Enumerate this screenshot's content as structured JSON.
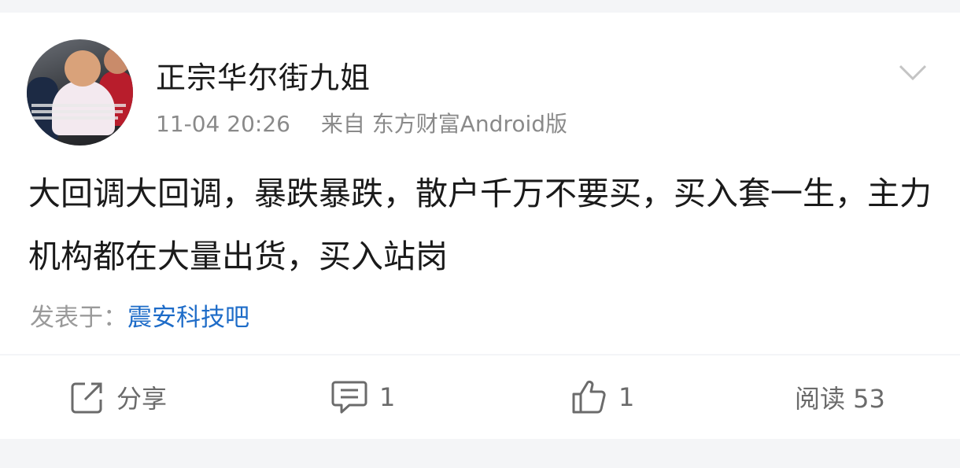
{
  "post": {
    "username": "正宗华尔街九姐",
    "time": "11-04 20:26",
    "source": "来自 东方财富Android版",
    "content": "大回调大回调，暴跌暴跌，散户千万不要买，买入套一生，主力机构都在大量出货，买入站岗",
    "posted_in_label": "发表于：",
    "forum": "震安科技吧"
  },
  "actions": {
    "share_label": "分享",
    "comment_count": "1",
    "like_count": "1",
    "read_label": "阅读 53"
  },
  "icons": {
    "expand": "chevron-down-icon",
    "share": "share-icon",
    "comment": "comment-icon",
    "like": "thumbs-up-icon"
  },
  "colors": {
    "link": "#1e6cc8",
    "secondary_text": "#8a8a8a",
    "background": "#f4f5f7"
  }
}
